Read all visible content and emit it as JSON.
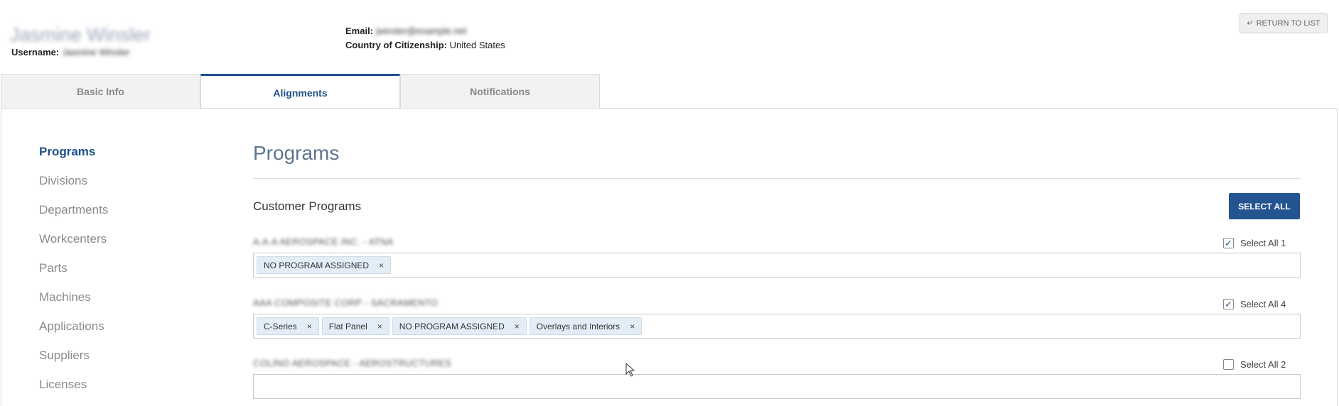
{
  "header": {
    "name": "Jasmine Winsler",
    "username_label": "Username:",
    "username_value": "Jasmine Winsler",
    "email_label": "Email:",
    "email_value": "jwinsler@example.net",
    "country_label": "Country of Citizenship:",
    "country_value": "United States",
    "return_label": "RETURN TO LIST"
  },
  "tabs": [
    {
      "label": "Basic Info"
    },
    {
      "label": "Alignments"
    },
    {
      "label": "Notifications"
    }
  ],
  "sidenav": [
    {
      "label": "Programs"
    },
    {
      "label": "Divisions"
    },
    {
      "label": "Departments"
    },
    {
      "label": "Workcenters"
    },
    {
      "label": "Parts"
    },
    {
      "label": "Machines"
    },
    {
      "label": "Applications"
    },
    {
      "label": "Suppliers"
    },
    {
      "label": "Licenses"
    }
  ],
  "main": {
    "title": "Programs",
    "section_title": "Customer Programs",
    "select_all_label": "SELECT ALL",
    "groups": [
      {
        "label": "A.A.A AEROSPACE INC. - ATNA",
        "select_all_label": "Select All 1",
        "checked": true,
        "tags": [
          "NO PROGRAM ASSIGNED"
        ]
      },
      {
        "label": "AAA COMPOSITE CORP - SACRAMENTO",
        "select_all_label": "Select All 4",
        "checked": true,
        "tags": [
          "C-Series",
          "Flat Panel",
          "NO PROGRAM ASSIGNED",
          "Overlays and Interiors"
        ]
      },
      {
        "label": "COLINO AEROSPACE - AEROSTRUCTURES",
        "select_all_label": "Select All 2",
        "checked": false,
        "tags": []
      }
    ]
  },
  "colors": {
    "accent": "#1f4f8a",
    "button": "#245490",
    "tag_bg": "#e2edf7"
  }
}
